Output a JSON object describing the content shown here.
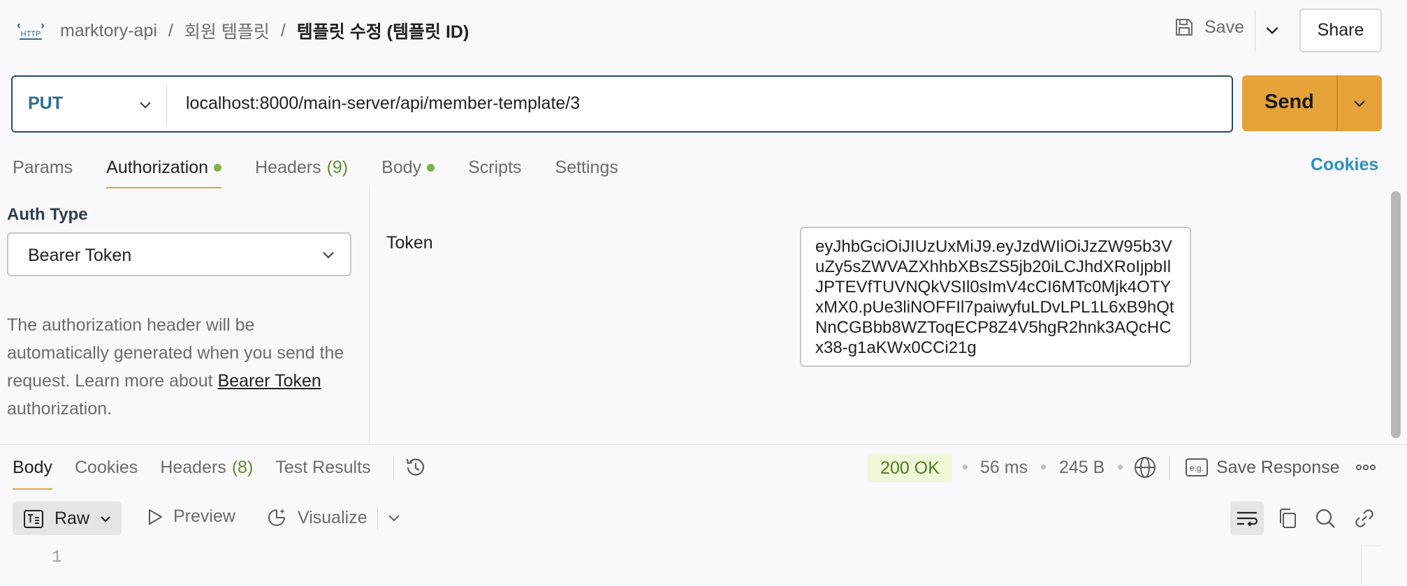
{
  "header": {
    "protocol_icon_text": "HTTP",
    "breadcrumbs": [
      "marktory-api",
      "회원 템플릿"
    ],
    "separator": "/",
    "current": "템플릿 수정 (템플릿 ID)",
    "save_label": "Save",
    "share_label": "Share"
  },
  "request": {
    "method": "PUT",
    "url": "localhost:8000/main-server/api/member-template/3",
    "send_label": "Send"
  },
  "tabs": {
    "params": "Params",
    "authorization": "Authorization",
    "headers": "Headers",
    "headers_count": "(9)",
    "body": "Body",
    "scripts": "Scripts",
    "settings": "Settings",
    "cookies": "Cookies"
  },
  "auth": {
    "type_label": "Auth Type",
    "type_value": "Bearer Token",
    "description": "The authorization header will be automatically generated when you send the request. Learn more about",
    "link_text": "Bearer Token",
    "description_end": "authorization.",
    "token_label": "Token",
    "token_value": "eyJhbGciOiJIUzUxMiJ9.eyJzdWIiOiJzZW95b3VuZy5sZWVAZXhhbXBsZS5jb20iLCJhdXRoIjpbIlJPTEVfTUVNQkVSIl0sImV4cCI6MTc0Mjk4OTYxMX0.pUe3liNOFFIl7paiwyfuLDvLPL1L6xB9hQtNnCGBbb8WZToqECP8Z4V5hgR2hnk3AQcHCx38-g1aKWx0CCi21g"
  },
  "response": {
    "tabs": {
      "body": "Body",
      "cookies": "Cookies",
      "headers": "Headers",
      "headers_count": "(8)",
      "test_results": "Test Results"
    },
    "status": "200 OK",
    "time": "56 ms",
    "size": "245 B",
    "save_response": "Save Response",
    "view_mode": "Raw",
    "preview": "Preview",
    "visualize": "Visualize",
    "line_number": "1"
  },
  "colors": {
    "accent": "#e5a238",
    "method": "#2b6c8f",
    "link": "#2b8fbd",
    "status_ok": "#4f7a1d",
    "dot": "#7cb342"
  },
  "icons": [
    "http-icon",
    "save-icon",
    "chevron-down-icon",
    "history-icon",
    "globe-icon",
    "example-icon",
    "more-icon",
    "raw-text-icon",
    "play-icon",
    "visualize-icon",
    "wrap-lines-icon",
    "copy-icon",
    "search-icon",
    "link-icon"
  ]
}
